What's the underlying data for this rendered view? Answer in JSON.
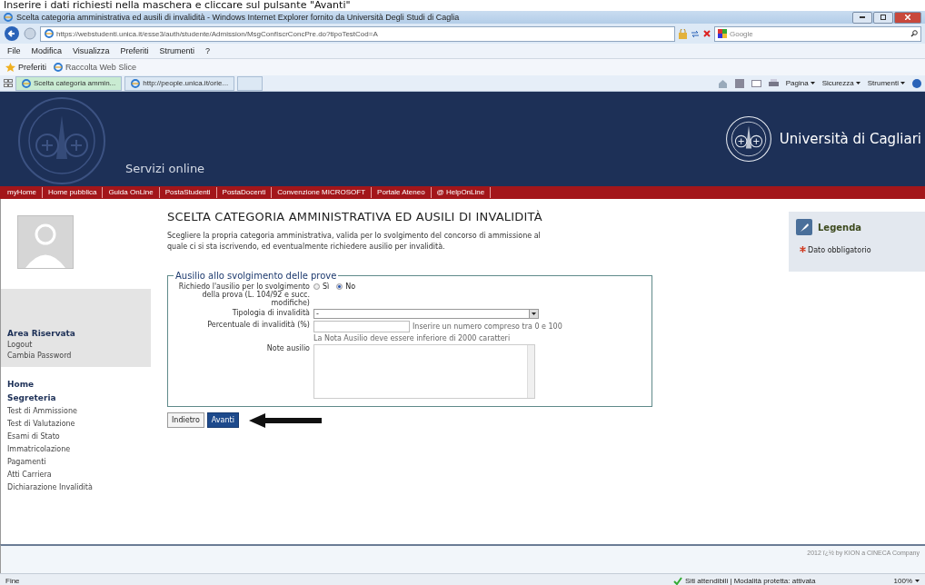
{
  "caption": "Inserire i dati richiesti nella maschera e cliccare sul pulsante \"Avanti\"",
  "browser": {
    "title": "Scelta categoria amministrativa ed ausili di invalidità - Windows Internet Explorer fornito da Università Degli Studi di Caglia",
    "url": "https://webstudenti.unica.it/esse3/auth/studente/Admission/MsgConfIscrConcPre.do?tipoTestCod=A",
    "search_placeholder": "Google",
    "menu": [
      "File",
      "Modifica",
      "Visualizza",
      "Preferiti",
      "Strumenti",
      "?"
    ],
    "favorites": "Preferiti",
    "web_slice": "Raccolta Web Slice",
    "tabs": [
      {
        "label": "Scelta categoria ammin...",
        "selected": true
      },
      {
        "label": "http://people.unica.it/orie...",
        "selected": false
      }
    ],
    "commands": [
      "Pagina",
      "Sicurezza",
      "Strumenti"
    ]
  },
  "header": {
    "subtitle": "Servizi online",
    "university": "Università di Cagliari"
  },
  "nav": [
    "myHome",
    "Home pubblica",
    "Guida OnLine",
    "PostaStudenti",
    "PostaDocenti",
    "Convenzione MICROSOFT",
    "Portale Ateneo",
    "@ HelpOnLine"
  ],
  "sidebar": {
    "area_title": "Area Riservata",
    "area_links": [
      "Logout",
      "Cambia Password"
    ],
    "home": "Home",
    "section": "Segreteria",
    "items": [
      "Test di Ammissione",
      "Test di Valutazione",
      "Esami di Stato",
      "Immatricolazione",
      "Pagamenti",
      "Atti Carriera",
      "Dichiarazione Invalidità"
    ]
  },
  "main": {
    "title": "SCELTA CATEGORIA AMMINISTRATIVA ED AUSILI DI INVALIDITÀ",
    "intro": "Scegliere la propria categoria amministrativa, valida per lo svolgimento del concorso di ammissione al quale ci si sta iscrivendo, ed eventualmente richiedere ausilio per invalidità.",
    "fieldset": {
      "legend": "Ausilio allo svolgimento delle prove",
      "question": "Richiedo l'ausilio per lo svolgimento della prova (L. 104/92 e succ. modifiche)",
      "options": [
        {
          "label": "Sì",
          "selected": false
        },
        {
          "label": "No",
          "selected": true
        }
      ],
      "type_label": "Tipologia di invalidità",
      "type_value": "-",
      "percent_label": "Percentuale di invalidità (%)",
      "percent_hint": "Inserire un numero compreso tra 0 e 100",
      "note_limit": "La Nota Ausilio deve essere inferiore di 2000 caratteri",
      "note_label": "Note ausilio"
    },
    "buttons": [
      {
        "label": "Indietro",
        "kind": "secondary"
      },
      {
        "label": "Avanti",
        "kind": "primary"
      }
    ]
  },
  "legend": {
    "title": "Legenda",
    "items": [
      "Dato obbligatorio"
    ]
  },
  "footer": "2012 ï¿½ by KION a CINECA Company",
  "status": {
    "left": "Fine",
    "zone": "Siti attendibili | Modalità protetta: attivata",
    "zoom": "100%"
  }
}
